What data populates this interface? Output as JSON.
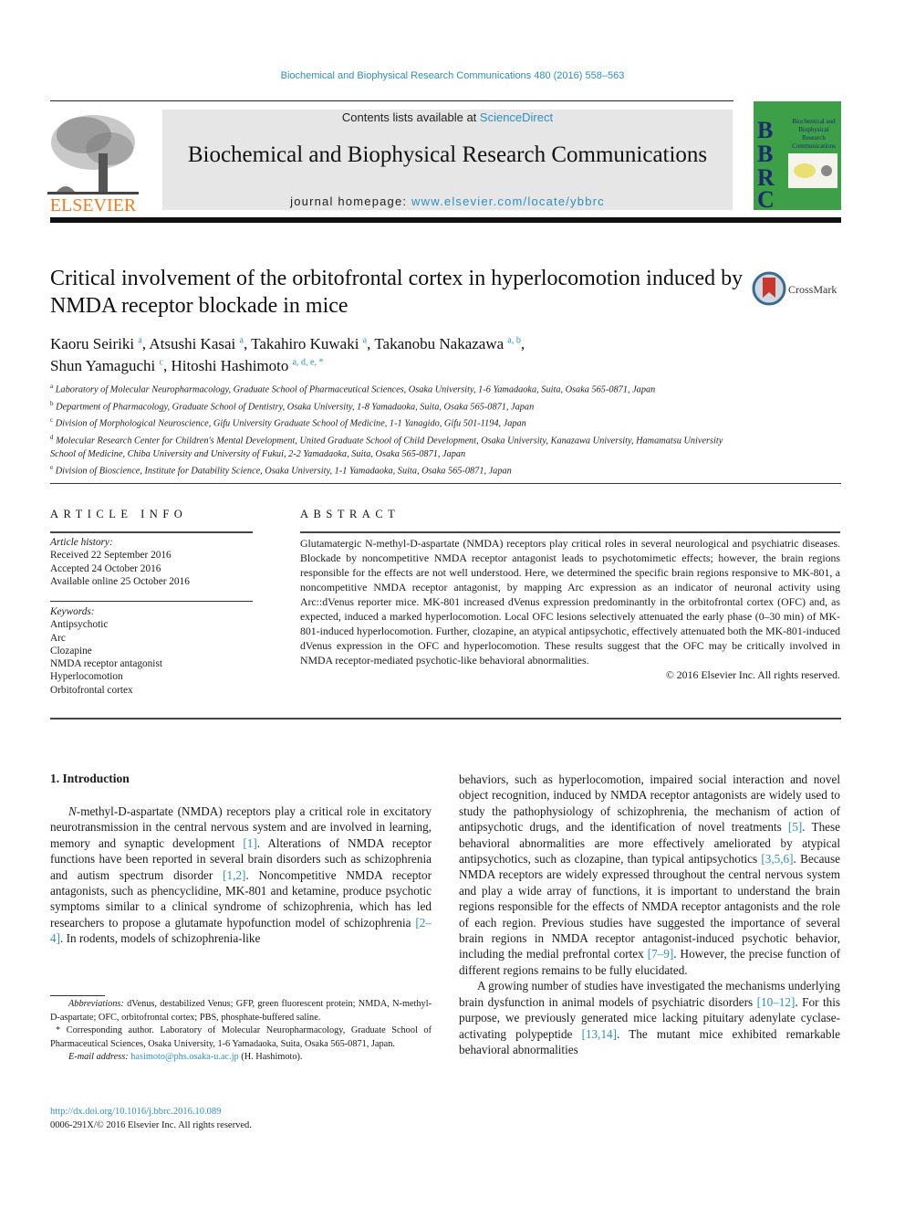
{
  "header": {
    "citation": "Biochemical and Biophysical Research Communications 480 (2016) 558–563",
    "contents_prefix": "Contents lists available at ",
    "contents_link": "ScienceDirect",
    "journal_title": "Biochemical and Biophysical Research Communications",
    "homepage_prefix": "journal homepage: ",
    "homepage_link": "www.elsevier.com/locate/ybbrc",
    "publisher_logo_text": "ELSEVIER",
    "cover": {
      "letters": [
        "B",
        "B",
        "R",
        "C"
      ],
      "title": "Biochemical and Biophysical Research Communications",
      "bg_color": "#3d9f48"
    },
    "crossmark_label": "CrossMark",
    "brand_color": "#f47b20",
    "link_color": "#2e8fc0"
  },
  "article": {
    "title": "Critical involvement of the orbitofrontal cortex in hyperlocomotion induced by NMDA receptor blockade in mice",
    "authors": [
      {
        "name": "Kaoru Seiriki",
        "aff": "a"
      },
      {
        "name": "Atsushi Kasai",
        "aff": "a"
      },
      {
        "name": "Takahiro Kuwaki",
        "aff": "a"
      },
      {
        "name": "Takanobu Nakazawa",
        "aff": "a, b"
      },
      {
        "name": "Shun Yamaguchi",
        "aff": "c"
      },
      {
        "name": "Hitoshi Hashimoto",
        "aff": "a, d, e, *"
      }
    ],
    "affiliations": [
      {
        "key": "a",
        "text": "Laboratory of Molecular Neuropharmacology, Graduate School of Pharmaceutical Sciences, Osaka University, 1-6 Yamadaoka, Suita, Osaka 565-0871, Japan"
      },
      {
        "key": "b",
        "text": "Department of Pharmacology, Graduate School of Dentistry, Osaka University, 1-8 Yamadaoka, Suita, Osaka 565-0871, Japan"
      },
      {
        "key": "c",
        "text": "Division of Morphological Neuroscience, Gifu University Graduate School of Medicine, 1-1 Yanagido, Gifu 501-1194, Japan"
      },
      {
        "key": "d",
        "text": "Molecular Research Center for Children's Mental Development, United Graduate School of Child Development, Osaka University, Kanazawa University, Hamamatsu University School of Medicine, Chiba University and University of Fukui, 2-2 Yamadaoka, Suita, Osaka 565-0871, Japan"
      },
      {
        "key": "e",
        "text": "Division of Bioscience, Institute for Datability Science, Osaka University, 1-1 Yamadaoka, Suita, Osaka 565-0871, Japan"
      }
    ]
  },
  "article_info": {
    "heading": "ARTICLE INFO",
    "history_label": "Article history:",
    "history": [
      "Received 22 September 2016",
      "Accepted 24 October 2016",
      "Available online 25 October 2016"
    ],
    "keywords_label": "Keywords:",
    "keywords": [
      "Antipsychotic",
      "Arc",
      "Clozapine",
      "NMDA receptor antagonist",
      "Hyperlocomotion",
      "Orbitofrontal cortex"
    ]
  },
  "abstract": {
    "heading": "ABSTRACT",
    "text": "Glutamatergic N-methyl-D-aspartate (NMDA) receptors play critical roles in several neurological and psychiatric diseases. Blockade by noncompetitive NMDA receptor antagonist leads to psychotomimetic effects; however, the brain regions responsible for the effects are not well understood. Here, we determined the specific brain regions responsive to MK-801, a noncompetitive NMDA receptor antagonist, by mapping Arc expression as an indicator of neuronal activity using Arc::dVenus reporter mice. MK-801 increased dVenus expression predominantly in the orbitofrontal cortex (OFC) and, as expected, induced a marked hyperlocomotion. Local OFC lesions selectively attenuated the early phase (0–30 min) of MK-801-induced hyperlocomotion. Further, clozapine, an atypical antipsychotic, effectively attenuated both the MK-801-induced dVenus expression in the OFC and hyperlocomotion. These results suggest that the OFC may be critically involved in NMDA receptor-mediated psychotic-like behavioral abnormalities.",
    "copyright": "© 2016 Elsevier Inc. All rights reserved."
  },
  "intro": {
    "heading": "1.  Introduction",
    "left_p1": [
      {
        "t": "N",
        "i": true
      },
      {
        "t": "-methyl-"
      },
      {
        "t": "D",
        "sc": true
      },
      {
        "t": "-aspartate (NMDA) receptors play a critical role in excitatory neurotransmission in the central nervous system and are involved in learning, memory and synaptic development "
      },
      {
        "t": "[1]",
        "link": true
      },
      {
        "t": ". Alterations of NMDA receptor functions have been reported in several brain disorders such as schizophrenia and autism spectrum disorder "
      },
      {
        "t": "[1,2]",
        "link": true
      },
      {
        "t": ". Noncompetitive NMDA receptor antagonists, such as phencyclidine, MK-801 and ketamine, produce psychotic symptoms similar to a clinical syndrome of schizophrenia, which has led researchers to propose a glutamate hypofunction model of schizophrenia "
      },
      {
        "t": "[2–4]",
        "link": true
      },
      {
        "t": ". In rodents, models of schizophrenia-like"
      }
    ],
    "right_p1": [
      {
        "t": "behaviors, such as hyperlocomotion, impaired social interaction and novel object recognition, induced by NMDA receptor antagonists are widely used to study the pathophysiology of schizophrenia, the mechanism of action of antipsychotic drugs, and the identification of novel treatments "
      },
      {
        "t": "[5]",
        "link": true
      },
      {
        "t": ". These behavioral abnormalities are more effectively ameliorated by atypical antipsychotics, such as clozapine, than typical antipsychotics "
      },
      {
        "t": "[3,5,6]",
        "link": true
      },
      {
        "t": ". Because NMDA receptors are widely expressed throughout the central nervous system and play a wide array of functions, it is important to understand the brain regions responsible for the effects of NMDA receptor antagonists and the role of each region. Previous studies have suggested the importance of several brain regions in NMDA receptor antagonist-induced psychotic behavior, including the medial prefrontal cortex "
      },
      {
        "t": "[7–9]",
        "link": true
      },
      {
        "t": ". However, the precise function of different regions remains to be fully elucidated."
      }
    ],
    "right_p2": [
      {
        "t": "A growing number of studies have investigated the mechanisms underlying brain dysfunction in animal models of psychiatric disorders "
      },
      {
        "t": "[10–12]",
        "link": true
      },
      {
        "t": ". For this purpose, we previously generated mice lacking pituitary adenylate cyclase-activating polypeptide "
      },
      {
        "t": "[13,14]",
        "link": true
      },
      {
        "t": ". The mutant mice exhibited remarkable behavioral abnormalities"
      }
    ]
  },
  "footnotes": {
    "abbrev_label": "Abbreviations:",
    "abbrev_text": " dVenus, destabilized Venus; GFP, green fluorescent protein; NMDA, N-methyl-D-aspartate; OFC, orbitofrontal cortex; PBS, phosphate-buffered saline.",
    "corresponding": "* Corresponding author. Laboratory of Molecular Neuropharmacology, Graduate School of Pharmaceutical Sciences, Osaka University, 1-6 Yamadaoka, Suita, Osaka 565-0871, Japan.",
    "email_label": "E-mail address:",
    "email": "hasimoto@phs.osaka-u.ac.jp",
    "email_suffix": " (H. Hashimoto).",
    "doi": "http://dx.doi.org/10.1016/j.bbrc.2016.10.089",
    "issn": "0006-291X/© 2016 Elsevier Inc. All rights reserved."
  }
}
